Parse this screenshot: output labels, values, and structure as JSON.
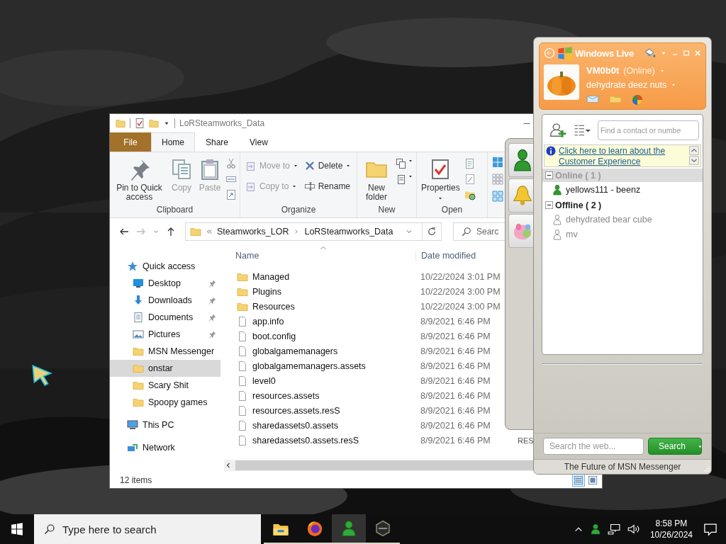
{
  "explorer": {
    "title": "LoRSteamworks_Data",
    "tabs": [
      {
        "label": "File",
        "kind": "file",
        "selected": false
      },
      {
        "label": "Home",
        "kind": "tab",
        "selected": true
      },
      {
        "label": "Share",
        "kind": "tab",
        "selected": false
      },
      {
        "label": "View",
        "kind": "tab",
        "selected": false
      }
    ],
    "ribbon": [
      {
        "label": "Clipboard",
        "commands": [
          {
            "label": "Pin to Quick access",
            "disabled": false
          },
          {
            "label": "Copy",
            "disabled": true
          },
          {
            "label": "Paste",
            "disabled": true
          }
        ]
      },
      {
        "label": "Organize",
        "commands": [
          {
            "label": "Move to",
            "disabled": true
          },
          {
            "label": "Copy to",
            "disabled": true
          },
          {
            "label": "Delete",
            "disabled": false
          },
          {
            "label": "Rename",
            "disabled": false
          }
        ]
      },
      {
        "label": "New",
        "commands": [
          {
            "label": "New folder",
            "disabled": false
          }
        ]
      },
      {
        "label": "Open",
        "commands": [
          {
            "label": "Properties",
            "disabled": false
          }
        ]
      }
    ],
    "address": [
      "Steamworks_LOR",
      "LoRSteamworks_Data"
    ],
    "search": {
      "placeholder": "Searc"
    },
    "columns": [
      "Name",
      "Date modified"
    ],
    "nav": [
      {
        "label": "Quick access",
        "kind": "star",
        "selected": false,
        "pinned": false,
        "children": [
          {
            "label": "Desktop",
            "kind": "desktop",
            "selected": false,
            "pinned": true
          },
          {
            "label": "Downloads",
            "kind": "download",
            "selected": false,
            "pinned": true
          },
          {
            "label": "Documents",
            "kind": "documents",
            "selected": false,
            "pinned": true
          },
          {
            "label": "Pictures",
            "kind": "pictures",
            "selected": false,
            "pinned": true
          },
          {
            "label": "MSN Messenger",
            "kind": "folder",
            "selected": false,
            "pinned": false
          },
          {
            "label": "onstar",
            "kind": "folder",
            "selected": true,
            "pinned": false
          },
          {
            "label": "Scary Shit",
            "kind": "folder",
            "selected": false,
            "pinned": false
          },
          {
            "label": "Spoopy games",
            "kind": "folder",
            "selected": false,
            "pinned": false
          }
        ]
      },
      {
        "label": "This PC",
        "kind": "pc",
        "selected": false,
        "pinned": false
      },
      {
        "label": "Network",
        "kind": "network",
        "selected": false,
        "pinned": false
      }
    ],
    "files": [
      {
        "name": "Managed",
        "kind": "folder",
        "date": "10/22/2024 3:01 PM"
      },
      {
        "name": "Plugins",
        "kind": "folder",
        "date": "10/22/2024 3:00 PM"
      },
      {
        "name": "Resources",
        "kind": "folder",
        "date": "10/22/2024 3:00 PM"
      },
      {
        "name": "app.info",
        "kind": "file",
        "date": "8/9/2021 6:46 PM"
      },
      {
        "name": "boot.config",
        "kind": "file",
        "date": "8/9/2021 6:46 PM"
      },
      {
        "name": "globalgamemanagers",
        "kind": "file",
        "date": "8/9/2021 6:46 PM"
      },
      {
        "name": "globalgamemanagers.assets",
        "kind": "file",
        "date": "8/9/2021 6:46 PM"
      },
      {
        "name": "level0",
        "kind": "file",
        "date": "8/9/2021 6:46 PM"
      },
      {
        "name": "resources.assets",
        "kind": "file",
        "date": "8/9/2021 6:46 PM"
      },
      {
        "name": "resources.assets.resS",
        "kind": "file",
        "date": "8/9/2021 6:46 PM"
      },
      {
        "name": "sharedassets0.assets",
        "kind": "file",
        "date": "8/9/2021 6:46 PM"
      },
      {
        "name": "sharedassets0.assets.resS",
        "kind": "file",
        "date": "8/9/2021 6:46 PM",
        "column_3": "RES"
      }
    ],
    "status": "12 items",
    "view_buttons": [
      {
        "selected": true
      },
      {
        "selected": false
      }
    ]
  },
  "messenger": {
    "brand": "Windows Live",
    "display_name": "VM0b0t",
    "status": "(Online)",
    "personal_message": "dehydrate deez nuts",
    "find_placeholder": "Find a contact or numbe",
    "banner": "Click here to learn about the Customer Experience",
    "groups": [
      {
        "label": "Online ( 1 )",
        "expanded": true,
        "selected": true,
        "contacts": [
          {
            "name": "yellows111 - beenz",
            "online": true
          }
        ]
      },
      {
        "label": "Offline ( 2 )",
        "expanded": true,
        "selected": false,
        "contacts": [
          {
            "name": "dehydrated bear cube",
            "online": false
          },
          {
            "name": "mv",
            "online": false
          }
        ]
      }
    ],
    "web_search_placeholder": "Search the web...",
    "search_button": "Search",
    "footer": "The Future of MSN Messenger"
  },
  "taskbar": {
    "search_placeholder": "Type here to search",
    "apps": [
      {
        "selected": false,
        "running": true
      },
      {
        "selected": false,
        "running": true
      },
      {
        "selected": true,
        "running": true
      },
      {
        "selected": false,
        "running": true
      }
    ],
    "time": "8:58 PM",
    "date": "10/26/2024"
  }
}
